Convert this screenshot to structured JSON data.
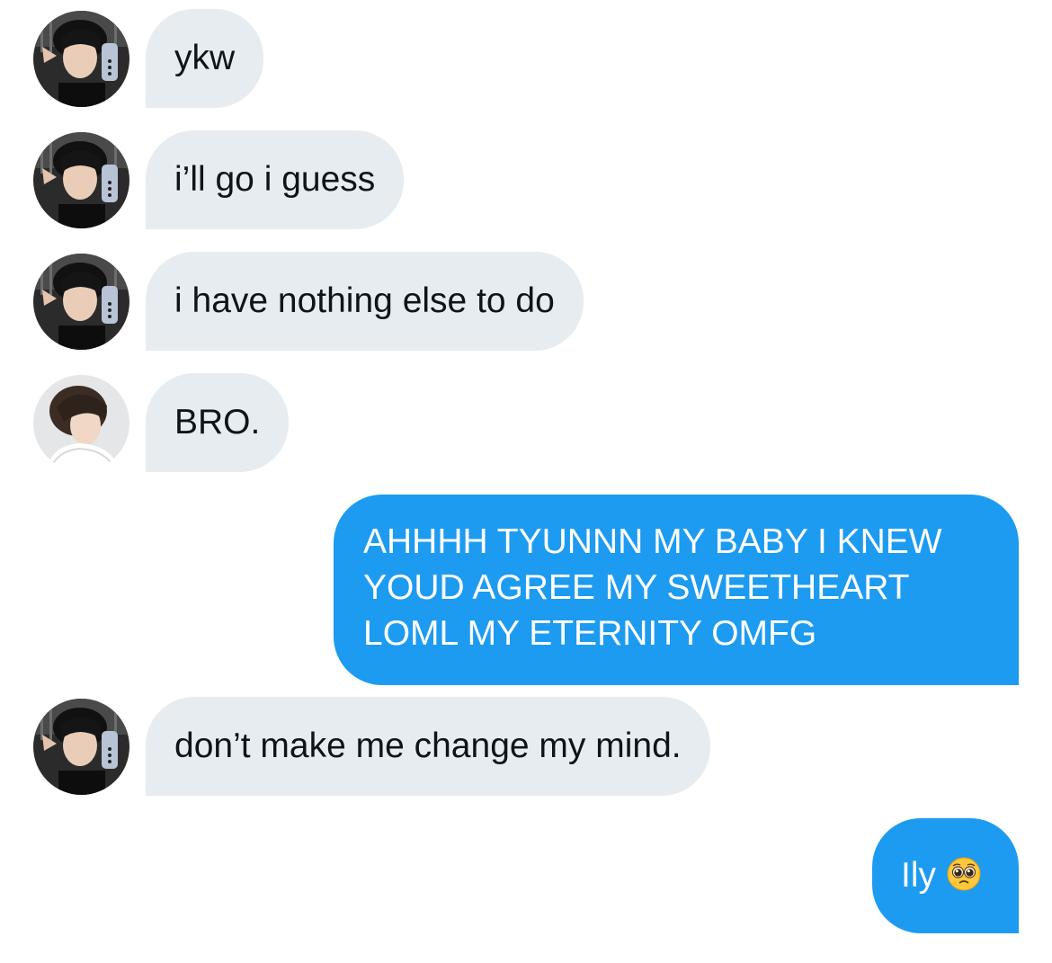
{
  "conversation": {
    "messages": [
      {
        "direction": "incoming",
        "sender": "friend-a",
        "text": "ykw"
      },
      {
        "direction": "incoming",
        "sender": "friend-a",
        "text": "i’ll go i guess"
      },
      {
        "direction": "incoming",
        "sender": "friend-a",
        "text": "i have nothing else to do"
      },
      {
        "direction": "incoming",
        "sender": "friend-b",
        "text": "BRO."
      },
      {
        "direction": "outgoing",
        "lines": [
          "AHHHH TYUNNN MY BABY I KNEW",
          "YOUD AGREE MY SWEETHEART",
          "LOML MY ETERNITY OMFG"
        ]
      },
      {
        "direction": "incoming",
        "sender": "friend-a",
        "text": "don’t make me change my mind."
      },
      {
        "direction": "outgoing",
        "text": "Ily",
        "emoji": "pleading-face-emoji"
      }
    ]
  },
  "colors": {
    "incoming_bubble": "#e7ecf0",
    "incoming_text": "#0f1419",
    "outgoing_bubble": "#1d9bf0",
    "outgoing_text": "#ffffff"
  }
}
